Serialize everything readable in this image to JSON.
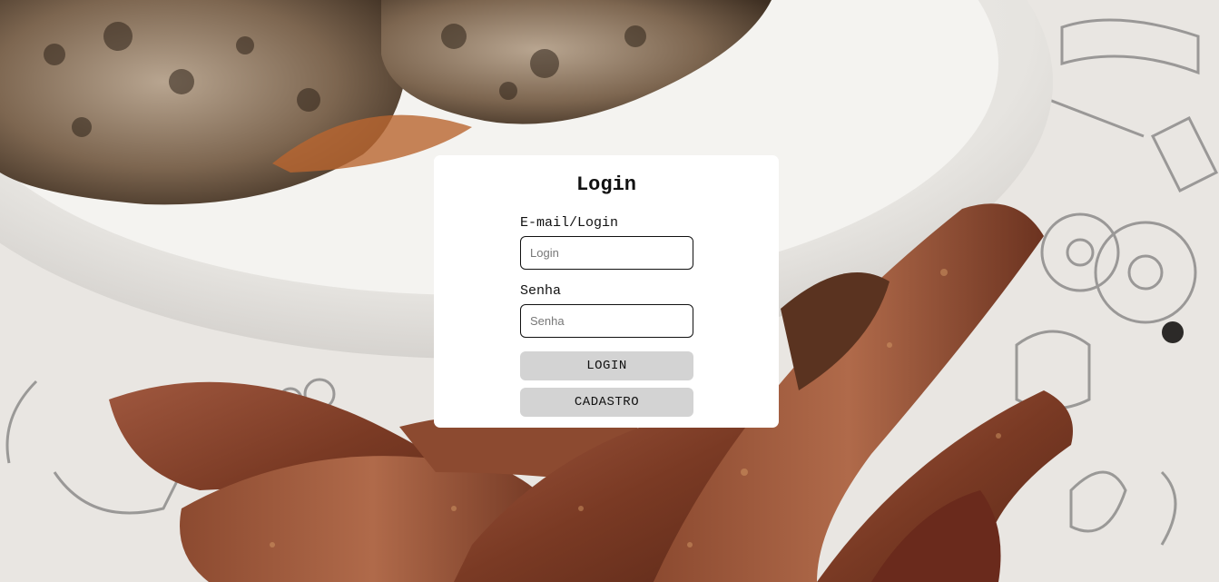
{
  "background": {
    "image": "food-photo-meat-plate"
  },
  "login_card": {
    "title": "Login",
    "email_label": "E-mail/Login",
    "email_placeholder": "Login",
    "email_value": "",
    "password_label": "Senha",
    "password_placeholder": "Senha",
    "password_value": "",
    "login_button": "LOGIN",
    "signup_button": "CADASTRO"
  },
  "colors": {
    "card_bg": "#ffffff",
    "button_bg": "#d3d3d3",
    "text": "#111111"
  }
}
